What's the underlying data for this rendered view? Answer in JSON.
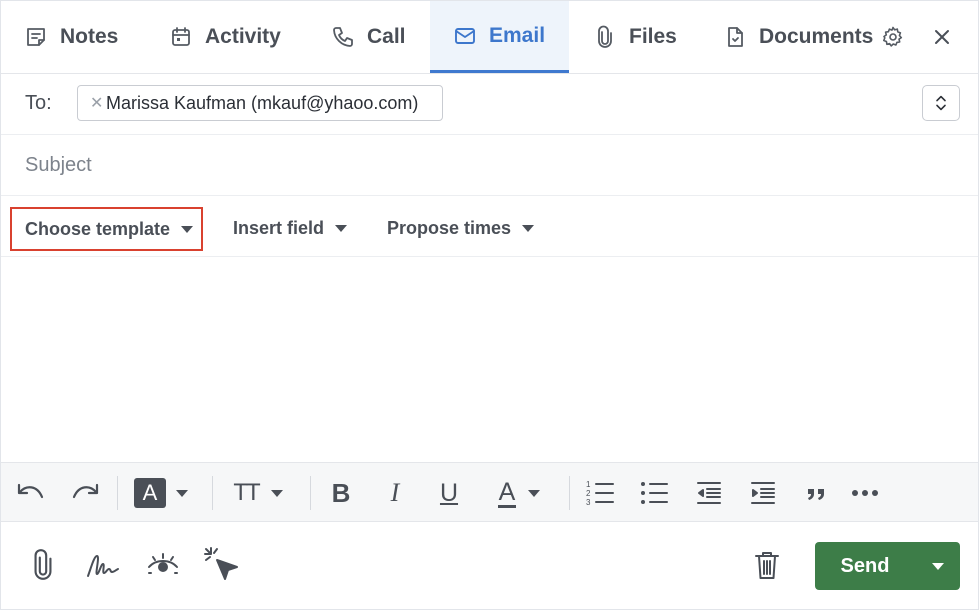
{
  "tabs": [
    {
      "label": "Notes",
      "icon": "notes-icon"
    },
    {
      "label": "Activity",
      "icon": "calendar-icon"
    },
    {
      "label": "Call",
      "icon": "phone-icon"
    },
    {
      "label": "Email",
      "icon": "envelope-icon",
      "active": true
    },
    {
      "label": "Files",
      "icon": "paperclip-icon"
    },
    {
      "label": "Documents",
      "icon": "document-icon"
    }
  ],
  "header_icons": {
    "settings": "gear-icon",
    "close": "close-icon"
  },
  "compose": {
    "to_label": "To:",
    "recipient": "Marissa Kaufman (mkauf@yhaoo.com)",
    "remove_glyph": "✕",
    "subject_placeholder": "Subject"
  },
  "template_bar": {
    "choose_template": "Choose template",
    "insert_field": "Insert field",
    "propose_times": "Propose times"
  },
  "format_toolbar": {
    "tools": [
      "undo-icon",
      "redo-icon",
      "highlight-icon",
      "text-size-icon",
      "bold-icon",
      "italic-icon",
      "underline-icon",
      "font-color-icon",
      "numbered-list-icon",
      "bulleted-list-icon",
      "outdent-icon",
      "indent-icon",
      "quote-icon",
      "more-icon"
    ],
    "highlight_letter": "A",
    "text_size_letters": "TT",
    "bold_letter": "B",
    "italic_letter": "I",
    "underline_letter": "U",
    "font_color_letter": "A"
  },
  "bottom_bar": {
    "tools": [
      "paperclip-icon",
      "signature-icon",
      "eye-tracking-icon",
      "cursor-click-icon",
      "trash-icon"
    ],
    "send_label": "Send"
  },
  "colors": {
    "accent_blue": "#3d77cc",
    "active_tab_bg": "#eef4fb",
    "highlight_border": "#d9412f",
    "send_green": "#3d7d48"
  }
}
